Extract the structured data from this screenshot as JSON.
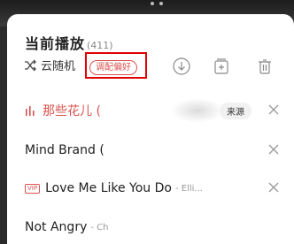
{
  "queue": {
    "title": "当前播放",
    "count": "(411)",
    "mode_label": "云随机",
    "preference_button": "调配偏好",
    "source_tag": "来源"
  },
  "songs": [
    {
      "name": "那些花儿 (",
      "artist": "",
      "active": true
    },
    {
      "name": "Mind Brand (",
      "artist": "",
      "active": false
    },
    {
      "name": "Love Me Like You Do",
      "artist": "- Elli...",
      "vip": "VIP",
      "active": false
    },
    {
      "name": "Not Angry",
      "artist": "- Ch",
      "active": false
    }
  ],
  "colors": {
    "accent": "#d9534f",
    "highlight_box": "#e00000"
  }
}
